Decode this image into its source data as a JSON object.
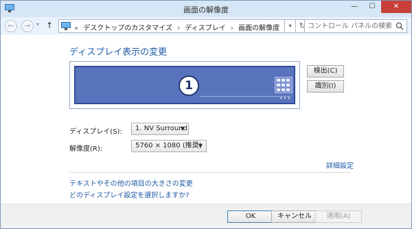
{
  "window": {
    "title": "画面の解像度",
    "minimize": "—",
    "maximize": "☐",
    "close": "✕"
  },
  "nav": {
    "back": "←",
    "forward": "→",
    "up": "↑",
    "breadcrumbs": [
      "«",
      "デスクトップのカスタマイズ",
      "›",
      "ディスプレイ",
      "›",
      "画面の解像度"
    ],
    "address_dropdown": "▾",
    "refresh": "↻",
    "search_placeholder": "コントロール パネルの検索"
  },
  "main": {
    "heading": "ディスプレイ表示の変更",
    "monitor_number": "1",
    "monitor_dots": "•••",
    "detect_button": "検出(C)",
    "identify_button": "識別(I)",
    "display_label": "ディスプレイ(S):",
    "display_value": "1. NV Surround",
    "resolution_label": "解像度(R):",
    "resolution_value": "5760 × 1080 (推奨)",
    "advanced_link": "詳細設定",
    "text_size_link": "テキストやその他の項目の大きさの変更",
    "which_settings_link": "どのディスプレイ設定を選択しますか?"
  },
  "footer": {
    "ok": "OK",
    "cancel": "キャンセル",
    "apply": "適用(A)"
  },
  "colors": {
    "accent": "#1e5aa6",
    "monitor": "#5a73bd",
    "close": "#c7403a"
  }
}
